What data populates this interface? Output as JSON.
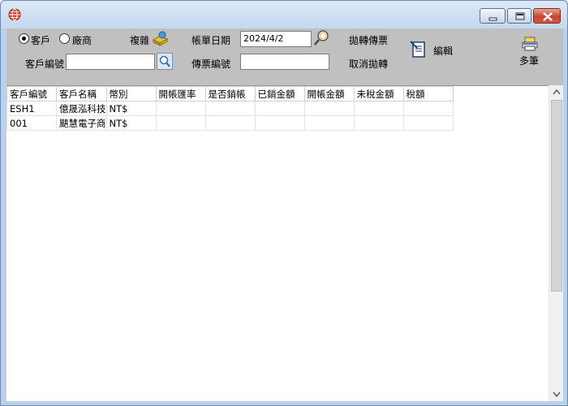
{
  "toolbar": {
    "radio_customer": "客戶",
    "radio_vendor": "廠商",
    "copy_label": "複雜",
    "account_date_label": "帳單日期",
    "account_date_value": "2024/4/2",
    "transfer_voucher_label": "拋轉傳票",
    "edit_label": "編輯",
    "multi_label": "多筆",
    "customer_code_label": "客戶編號",
    "customer_code_value": "",
    "voucher_no_label": "傳票編號",
    "voucher_no_value": "",
    "cancel_transfer_label": "取消拋轉"
  },
  "grid": {
    "columns": [
      "客戶編號",
      "客戶名稱",
      "幣別",
      "開帳匯率",
      "是否銷帳",
      "已銷金額",
      "開帳金額",
      "未稅金額",
      "稅額"
    ],
    "rows": [
      [
        "ESH1",
        "億晟泓科技",
        "NT$",
        "",
        "",
        "",
        "",
        "",
        ""
      ],
      [
        "001",
        "颶慧電子商",
        "NT$",
        "",
        "",
        "",
        "",
        "",
        ""
      ]
    ]
  }
}
